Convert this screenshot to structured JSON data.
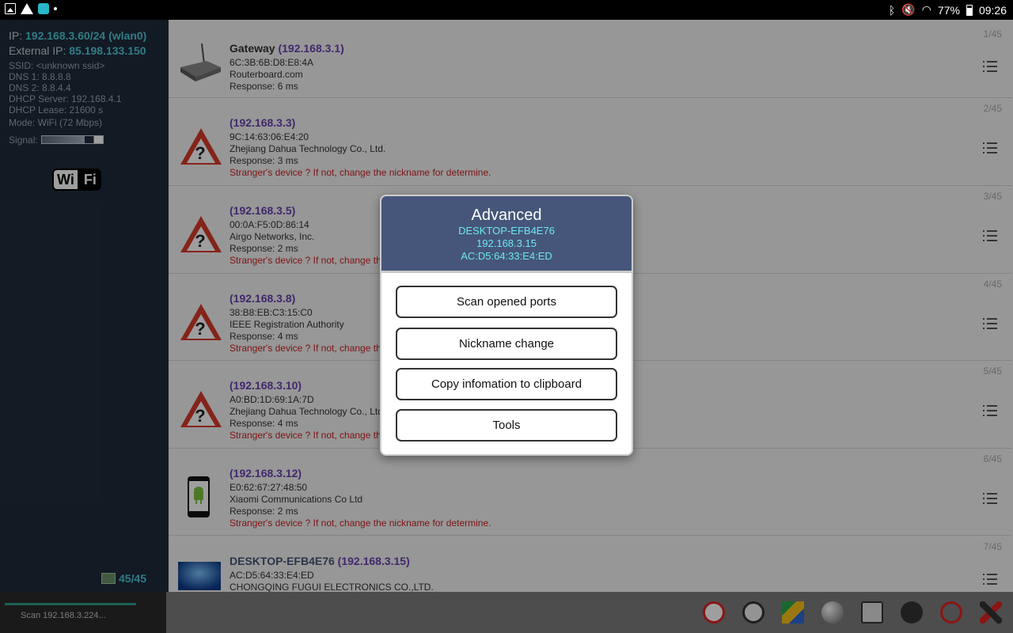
{
  "statusbar": {
    "battery": "77%",
    "time": "09:26"
  },
  "left": {
    "ip_label": "IP:",
    "ip": "192.168.3.60/24 (wlan0)",
    "ext_label": "External IP:",
    "ext_ip": "85.198.133.150",
    "ssid": "SSID: <unknown ssid>",
    "dns1": "DNS 1: 8.8.8.8",
    "dns2": "DNS 2: 8.8.4.4",
    "dhcp_server": "DHCP Server: 192.168.4.1",
    "dhcp_lease": "DHCP Lease: 21600 s",
    "mode": "Mode: WiFi (72 Mbps)",
    "signal_label": "Signal:",
    "wifi_logo_wi": "Wi",
    "wifi_logo_fi": "Fi",
    "count": "45/45"
  },
  "devices": [
    {
      "name": "Gateway",
      "ip": "(192.168.3.1)",
      "mac": "6C:3B:6B:D8:E8:4A",
      "vendor": "Routerboard.com",
      "response": "Response: 6 ms",
      "warn": "",
      "num": "1/45",
      "icon": "router-icon"
    },
    {
      "name": "",
      "ip": "(192.168.3.3)",
      "mac": "9C:14:63:06:E4:20",
      "vendor": "Zhejiang Dahua Technology Co., Ltd.",
      "response": "Response: 3 ms",
      "warn": "Stranger's device ? If not, change the nickname for determine.",
      "num": "2/45",
      "icon": "unknown-device-icon"
    },
    {
      "name": "",
      "ip": "(192.168.3.5)",
      "mac": "00:0A:F5:0D:86:14",
      "vendor": "Airgo Networks, Inc.",
      "response": "Response: 2 ms",
      "warn": "Stranger's device ? If not, change the",
      "num": "3/45",
      "icon": "unknown-device-icon"
    },
    {
      "name": "",
      "ip": "(192.168.3.8)",
      "mac": "38:B8:EB:C3:15:C0",
      "vendor": "IEEE Registration Authority",
      "response": "Response: 4 ms",
      "warn": "Stranger's device ? If not, change the",
      "num": "4/45",
      "icon": "unknown-device-icon"
    },
    {
      "name": "",
      "ip": "(192.168.3.10)",
      "mac": "A0:BD:1D:69:1A:7D",
      "vendor": "Zhejiang Dahua Technology Co., Ltd",
      "response": "Response: 4 ms",
      "warn": "Stranger's device ? If not, change the",
      "num": "5/45",
      "icon": "unknown-device-icon"
    },
    {
      "name": "",
      "ip": "(192.168.3.12)",
      "mac": "E0:62:67:27:48:50",
      "vendor": "Xiaomi Communications Co Ltd",
      "response": "Response: 2 ms",
      "warn": "Stranger's device ? If not, change the nickname for determine.",
      "num": "6/45",
      "icon": "android-phone-icon"
    },
    {
      "name": "DESKTOP-EFB4E76",
      "ip": "(192.168.3.15)",
      "mac": "AC:D5:64:33:E4:ED",
      "vendor": "CHONGQING FUGUI ELECTRONICS CO.,LTD.",
      "response": "",
      "warn": "",
      "num": "7/45",
      "icon": "windows-pc-icon"
    }
  ],
  "scan": {
    "text": "Scan 192.168.3.224..."
  },
  "dialog": {
    "title": "Advanced",
    "hostname": "DESKTOP-EFB4E76",
    "ip": "192.168.3.15",
    "mac": "AC:D5:64:33:E4:ED",
    "buttons": [
      "Scan opened ports",
      "Nickname change",
      "Copy infomation to clipboard",
      "Tools"
    ]
  },
  "toolbar_icons": [
    "no-ads-icon",
    "timer-icon",
    "drive-icon",
    "globe-icon",
    "calculator-icon",
    "share-icon",
    "block-icon",
    "tools-icon"
  ],
  "colors": {
    "accent": "#4fc9d8",
    "dialog_header": "#45567a",
    "warning": "#cc2222"
  }
}
